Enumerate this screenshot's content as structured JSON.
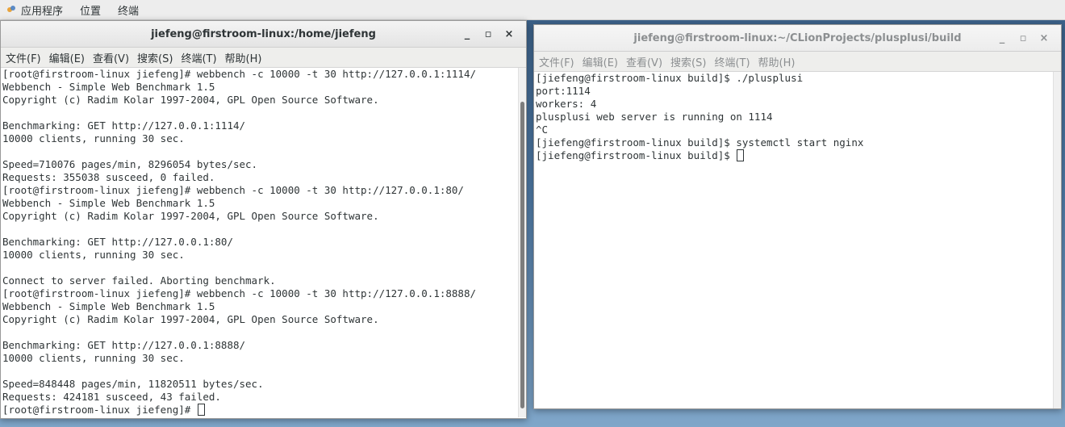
{
  "topbar": {
    "applications": "应用程序",
    "places": "位置",
    "terminal": "终端"
  },
  "windows": [
    {
      "title": "jiefeng@firstroom-linux:/home/jiefeng",
      "controls": [
        "_",
        "▫",
        "×"
      ],
      "menu": [
        "文件(F)",
        "编辑(E)",
        "查看(V)",
        "搜索(S)",
        "终端(T)",
        "帮助(H)"
      ],
      "lines": [
        "[root@firstroom-linux jiefeng]# webbench -c 10000 -t 30 http://127.0.0.1:1114/",
        "Webbench - Simple Web Benchmark 1.5",
        "Copyright (c) Radim Kolar 1997-2004, GPL Open Source Software.",
        "",
        "Benchmarking: GET http://127.0.0.1:1114/",
        "10000 clients, running 30 sec.",
        "",
        "Speed=710076 pages/min, 8296054 bytes/sec.",
        "Requests: 355038 susceed, 0 failed.",
        "[root@firstroom-linux jiefeng]# webbench -c 10000 -t 30 http://127.0.0.1:80/",
        "Webbench - Simple Web Benchmark 1.5",
        "Copyright (c) Radim Kolar 1997-2004, GPL Open Source Software.",
        "",
        "Benchmarking: GET http://127.0.0.1:80/",
        "10000 clients, running 30 sec.",
        "",
        "Connect to server failed. Aborting benchmark.",
        "[root@firstroom-linux jiefeng]# webbench -c 10000 -t 30 http://127.0.0.1:8888/",
        "Webbench - Simple Web Benchmark 1.5",
        "Copyright (c) Radim Kolar 1997-2004, GPL Open Source Software.",
        "",
        "Benchmarking: GET http://127.0.0.1:8888/",
        "10000 clients, running 30 sec.",
        "",
        "Speed=848448 pages/min, 11820511 bytes/sec.",
        "Requests: 424181 susceed, 43 failed."
      ],
      "prompt": "[root@firstroom-linux jiefeng]# "
    },
    {
      "title": "jiefeng@firstroom-linux:~/CLionProjects/plusplusi/build",
      "controls": [
        "_",
        "▫",
        "×"
      ],
      "menu": [
        "文件(F)",
        "编辑(E)",
        "查看(V)",
        "搜索(S)",
        "终端(T)",
        "帮助(H)"
      ],
      "lines": [
        "[jiefeng@firstroom-linux build]$ ./plusplusi",
        "port:1114",
        "workers: 4",
        "plusplusi web server is running on 1114",
        "^C",
        "[jiefeng@firstroom-linux build]$ systemctl start nginx"
      ],
      "prompt": "[jiefeng@firstroom-linux build]$ "
    }
  ]
}
